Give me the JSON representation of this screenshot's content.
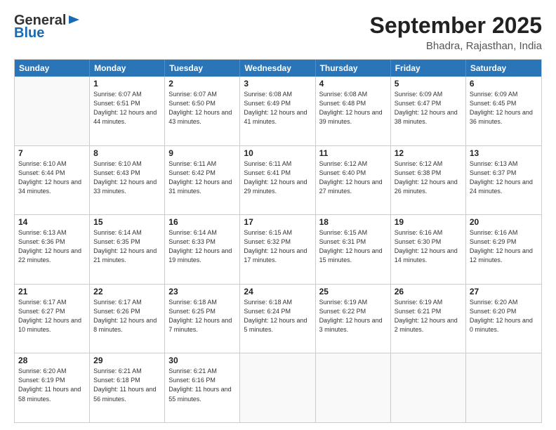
{
  "logo": {
    "general": "General",
    "blue": "Blue"
  },
  "title": {
    "month": "September 2025",
    "location": "Bhadra, Rajasthan, India"
  },
  "header_days": [
    "Sunday",
    "Monday",
    "Tuesday",
    "Wednesday",
    "Thursday",
    "Friday",
    "Saturday"
  ],
  "weeks": [
    [
      {
        "day": "",
        "sunrise": "",
        "sunset": "",
        "daylight": ""
      },
      {
        "day": "1",
        "sunrise": "Sunrise: 6:07 AM",
        "sunset": "Sunset: 6:51 PM",
        "daylight": "Daylight: 12 hours and 44 minutes."
      },
      {
        "day": "2",
        "sunrise": "Sunrise: 6:07 AM",
        "sunset": "Sunset: 6:50 PM",
        "daylight": "Daylight: 12 hours and 43 minutes."
      },
      {
        "day": "3",
        "sunrise": "Sunrise: 6:08 AM",
        "sunset": "Sunset: 6:49 PM",
        "daylight": "Daylight: 12 hours and 41 minutes."
      },
      {
        "day": "4",
        "sunrise": "Sunrise: 6:08 AM",
        "sunset": "Sunset: 6:48 PM",
        "daylight": "Daylight: 12 hours and 39 minutes."
      },
      {
        "day": "5",
        "sunrise": "Sunrise: 6:09 AM",
        "sunset": "Sunset: 6:47 PM",
        "daylight": "Daylight: 12 hours and 38 minutes."
      },
      {
        "day": "6",
        "sunrise": "Sunrise: 6:09 AM",
        "sunset": "Sunset: 6:45 PM",
        "daylight": "Daylight: 12 hours and 36 minutes."
      }
    ],
    [
      {
        "day": "7",
        "sunrise": "Sunrise: 6:10 AM",
        "sunset": "Sunset: 6:44 PM",
        "daylight": "Daylight: 12 hours and 34 minutes."
      },
      {
        "day": "8",
        "sunrise": "Sunrise: 6:10 AM",
        "sunset": "Sunset: 6:43 PM",
        "daylight": "Daylight: 12 hours and 33 minutes."
      },
      {
        "day": "9",
        "sunrise": "Sunrise: 6:11 AM",
        "sunset": "Sunset: 6:42 PM",
        "daylight": "Daylight: 12 hours and 31 minutes."
      },
      {
        "day": "10",
        "sunrise": "Sunrise: 6:11 AM",
        "sunset": "Sunset: 6:41 PM",
        "daylight": "Daylight: 12 hours and 29 minutes."
      },
      {
        "day": "11",
        "sunrise": "Sunrise: 6:12 AM",
        "sunset": "Sunset: 6:40 PM",
        "daylight": "Daylight: 12 hours and 27 minutes."
      },
      {
        "day": "12",
        "sunrise": "Sunrise: 6:12 AM",
        "sunset": "Sunset: 6:38 PM",
        "daylight": "Daylight: 12 hours and 26 minutes."
      },
      {
        "day": "13",
        "sunrise": "Sunrise: 6:13 AM",
        "sunset": "Sunset: 6:37 PM",
        "daylight": "Daylight: 12 hours and 24 minutes."
      }
    ],
    [
      {
        "day": "14",
        "sunrise": "Sunrise: 6:13 AM",
        "sunset": "Sunset: 6:36 PM",
        "daylight": "Daylight: 12 hours and 22 minutes."
      },
      {
        "day": "15",
        "sunrise": "Sunrise: 6:14 AM",
        "sunset": "Sunset: 6:35 PM",
        "daylight": "Daylight: 12 hours and 21 minutes."
      },
      {
        "day": "16",
        "sunrise": "Sunrise: 6:14 AM",
        "sunset": "Sunset: 6:33 PM",
        "daylight": "Daylight: 12 hours and 19 minutes."
      },
      {
        "day": "17",
        "sunrise": "Sunrise: 6:15 AM",
        "sunset": "Sunset: 6:32 PM",
        "daylight": "Daylight: 12 hours and 17 minutes."
      },
      {
        "day": "18",
        "sunrise": "Sunrise: 6:15 AM",
        "sunset": "Sunset: 6:31 PM",
        "daylight": "Daylight: 12 hours and 15 minutes."
      },
      {
        "day": "19",
        "sunrise": "Sunrise: 6:16 AM",
        "sunset": "Sunset: 6:30 PM",
        "daylight": "Daylight: 12 hours and 14 minutes."
      },
      {
        "day": "20",
        "sunrise": "Sunrise: 6:16 AM",
        "sunset": "Sunset: 6:29 PM",
        "daylight": "Daylight: 12 hours and 12 minutes."
      }
    ],
    [
      {
        "day": "21",
        "sunrise": "Sunrise: 6:17 AM",
        "sunset": "Sunset: 6:27 PM",
        "daylight": "Daylight: 12 hours and 10 minutes."
      },
      {
        "day": "22",
        "sunrise": "Sunrise: 6:17 AM",
        "sunset": "Sunset: 6:26 PM",
        "daylight": "Daylight: 12 hours and 8 minutes."
      },
      {
        "day": "23",
        "sunrise": "Sunrise: 6:18 AM",
        "sunset": "Sunset: 6:25 PM",
        "daylight": "Daylight: 12 hours and 7 minutes."
      },
      {
        "day": "24",
        "sunrise": "Sunrise: 6:18 AM",
        "sunset": "Sunset: 6:24 PM",
        "daylight": "Daylight: 12 hours and 5 minutes."
      },
      {
        "day": "25",
        "sunrise": "Sunrise: 6:19 AM",
        "sunset": "Sunset: 6:22 PM",
        "daylight": "Daylight: 12 hours and 3 minutes."
      },
      {
        "day": "26",
        "sunrise": "Sunrise: 6:19 AM",
        "sunset": "Sunset: 6:21 PM",
        "daylight": "Daylight: 12 hours and 2 minutes."
      },
      {
        "day": "27",
        "sunrise": "Sunrise: 6:20 AM",
        "sunset": "Sunset: 6:20 PM",
        "daylight": "Daylight: 12 hours and 0 minutes."
      }
    ],
    [
      {
        "day": "28",
        "sunrise": "Sunrise: 6:20 AM",
        "sunset": "Sunset: 6:19 PM",
        "daylight": "Daylight: 11 hours and 58 minutes."
      },
      {
        "day": "29",
        "sunrise": "Sunrise: 6:21 AM",
        "sunset": "Sunset: 6:18 PM",
        "daylight": "Daylight: 11 hours and 56 minutes."
      },
      {
        "day": "30",
        "sunrise": "Sunrise: 6:21 AM",
        "sunset": "Sunset: 6:16 PM",
        "daylight": "Daylight: 11 hours and 55 minutes."
      },
      {
        "day": "",
        "sunrise": "",
        "sunset": "",
        "daylight": ""
      },
      {
        "day": "",
        "sunrise": "",
        "sunset": "",
        "daylight": ""
      },
      {
        "day": "",
        "sunrise": "",
        "sunset": "",
        "daylight": ""
      },
      {
        "day": "",
        "sunrise": "",
        "sunset": "",
        "daylight": ""
      }
    ]
  ]
}
